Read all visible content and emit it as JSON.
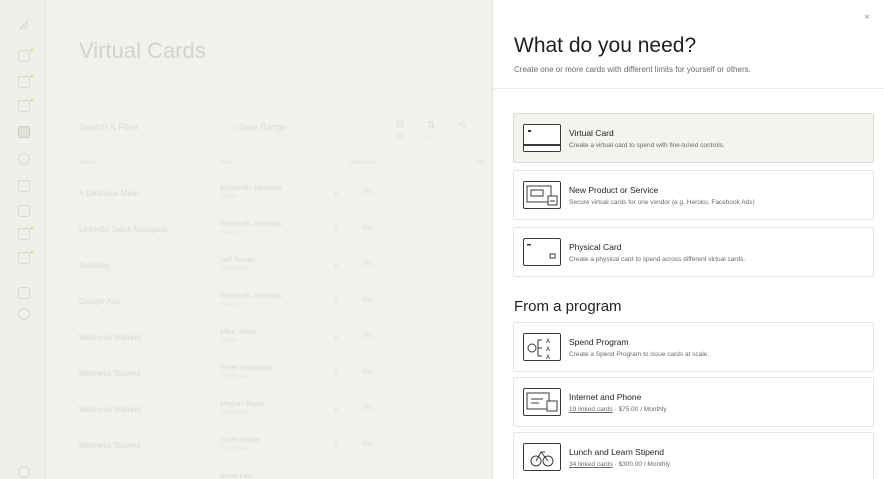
{
  "background": {
    "page_title": "Virtual Cards",
    "search_placeholder": "Search & Filter",
    "date_range_placeholder": "Date Range",
    "toolbar_glyphs": "⊟ ⇅ ∿ ⊙ ⌵",
    "columns": [
      "Name",
      "User",
      "Utilization",
      "Am"
    ],
    "rows": [
      {
        "name": "A Delicious Meal",
        "user": "Elizabeth Johnson",
        "role": "Owner",
        "pct": "0%"
      },
      {
        "name": "LinkedIn Sales Navigator",
        "user": "Elizabeth Johnson",
        "role": "Owner",
        "pct": "0%"
      },
      {
        "name": "Datadog",
        "user": "Jeff Turner",
        "role": "Employee",
        "pct": "0%"
      },
      {
        "name": "Google Ads",
        "user": "Elizabeth Johnson",
        "role": "Owner",
        "pct": "0%"
      },
      {
        "name": "Wellness Stipend",
        "user": "Mike Wade",
        "role": "Admin",
        "pct": "0%"
      },
      {
        "name": "Wellness Stipend",
        "user": "Peter Robinson",
        "role": "Employee",
        "pct": "0%"
      },
      {
        "name": "Wellness Stipend",
        "user": "Megan Taylor",
        "role": "Employee",
        "pct": "0%"
      },
      {
        "name": "Wellness Stipend",
        "user": "Scott Moore",
        "role": "Employee",
        "pct": "0%"
      },
      {
        "name": "",
        "user": "Anna Lee",
        "role": "",
        "pct": ""
      }
    ]
  },
  "panel": {
    "close_label": "×",
    "title": "What do you need?",
    "subtitle": "Create one or more cards with different limits for yourself or others.",
    "options": [
      {
        "icon": "virtual-card-icon",
        "title": "Virtual Card",
        "desc": "Create a virtual card to spend with fine-tuned controls."
      },
      {
        "icon": "vendor-card-icon",
        "title": "New Product or Service",
        "desc": "Secure virtual cards for one vendor (e.g. Heroku, Facebook Ads)"
      },
      {
        "icon": "physical-card-icon",
        "title": "Physical Card",
        "desc": "Create a physical card to spend across different virtual cards."
      }
    ],
    "program_section_title": "From a program",
    "programs": [
      {
        "icon": "spend-program-icon",
        "title": "Spend Program",
        "desc": "Create a Spend Program to issue cards at scale."
      },
      {
        "icon": "internet-phone-icon",
        "title": "Internet and Phone",
        "link": "19 linked cards",
        "desc": " · $75.00 / Monthly"
      },
      {
        "icon": "lunch-learn-icon",
        "title": "Lunch and Learn Stipend",
        "link": "34 linked cards",
        "desc": " · $300.00 / Monthly"
      }
    ]
  },
  "colors": {
    "accent_dot": "#e8d48a",
    "selected_bg": "#f4f3ee"
  }
}
